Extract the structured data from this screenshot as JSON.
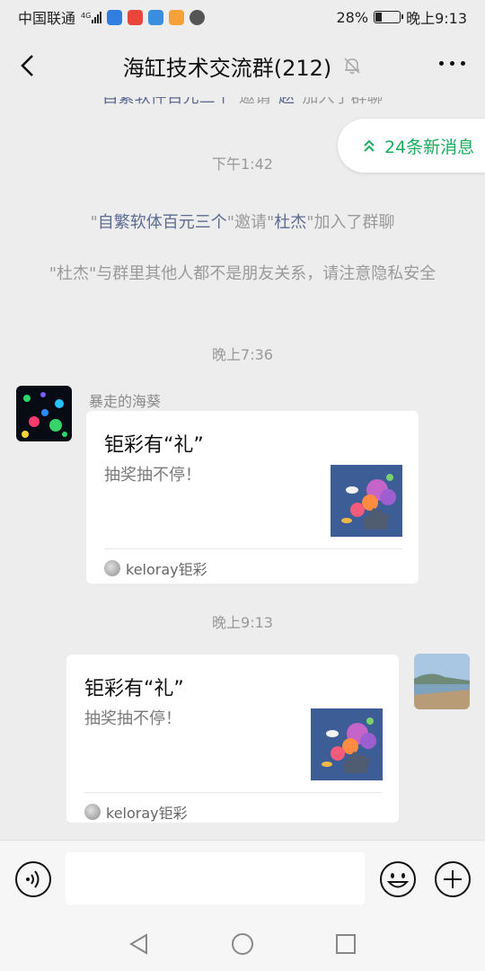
{
  "status_bar": {
    "carrier": "中国联通",
    "network": "4G",
    "battery": "28%",
    "battery_level": 0.28,
    "time": "晚上9:13"
  },
  "header": {
    "title": "海缸技术交流群(212)",
    "muted_icon": "bell-off-icon",
    "back_icon": "chevron-left-icon",
    "more_icon": "more-dots-icon"
  },
  "chat": {
    "partial_top": {
      "p1": "自繁软件百元三个",
      "p2": "\"邀请\"",
      "p3": "赵",
      "p4": "\"加入了群聊"
    },
    "new_messages": "24条新消息",
    "time_1": "下午1:42",
    "invite": {
      "q1": "\"",
      "inviter": "自繁软体百元三个",
      "mid": "\"邀请\"",
      "invitee": "杜杰",
      "end": "\"加入了群聊"
    },
    "privacy_notice": "\"杜杰\"与群里其他人都不是朋友关系，请注意隐私安全",
    "time_2": "晚上7:36",
    "message_1": {
      "sender": "暴走的海葵",
      "card_title": "钜彩有“礼”",
      "card_desc": "抽奖抽不停！",
      "card_source": "keloray钜彩"
    },
    "time_3": "晚上9:13",
    "message_2": {
      "card_title": "钜彩有“礼”",
      "card_desc": "抽奖抽不停！",
      "card_source": "keloray钜彩"
    }
  },
  "input_bar": {
    "voice_icon": "voice-icon",
    "emoji_icon": "emoji-icon",
    "plus_icon": "plus-icon",
    "input_value": ""
  },
  "nav_bar": {
    "back_icon": "triangle-back-icon",
    "home_icon": "circle-home-icon",
    "recent_icon": "square-recent-icon"
  },
  "colors": {
    "background": "#ededed",
    "link_name": "#5b6b92",
    "new_msg_green": "#1aad5d",
    "card": "#ffffff"
  }
}
